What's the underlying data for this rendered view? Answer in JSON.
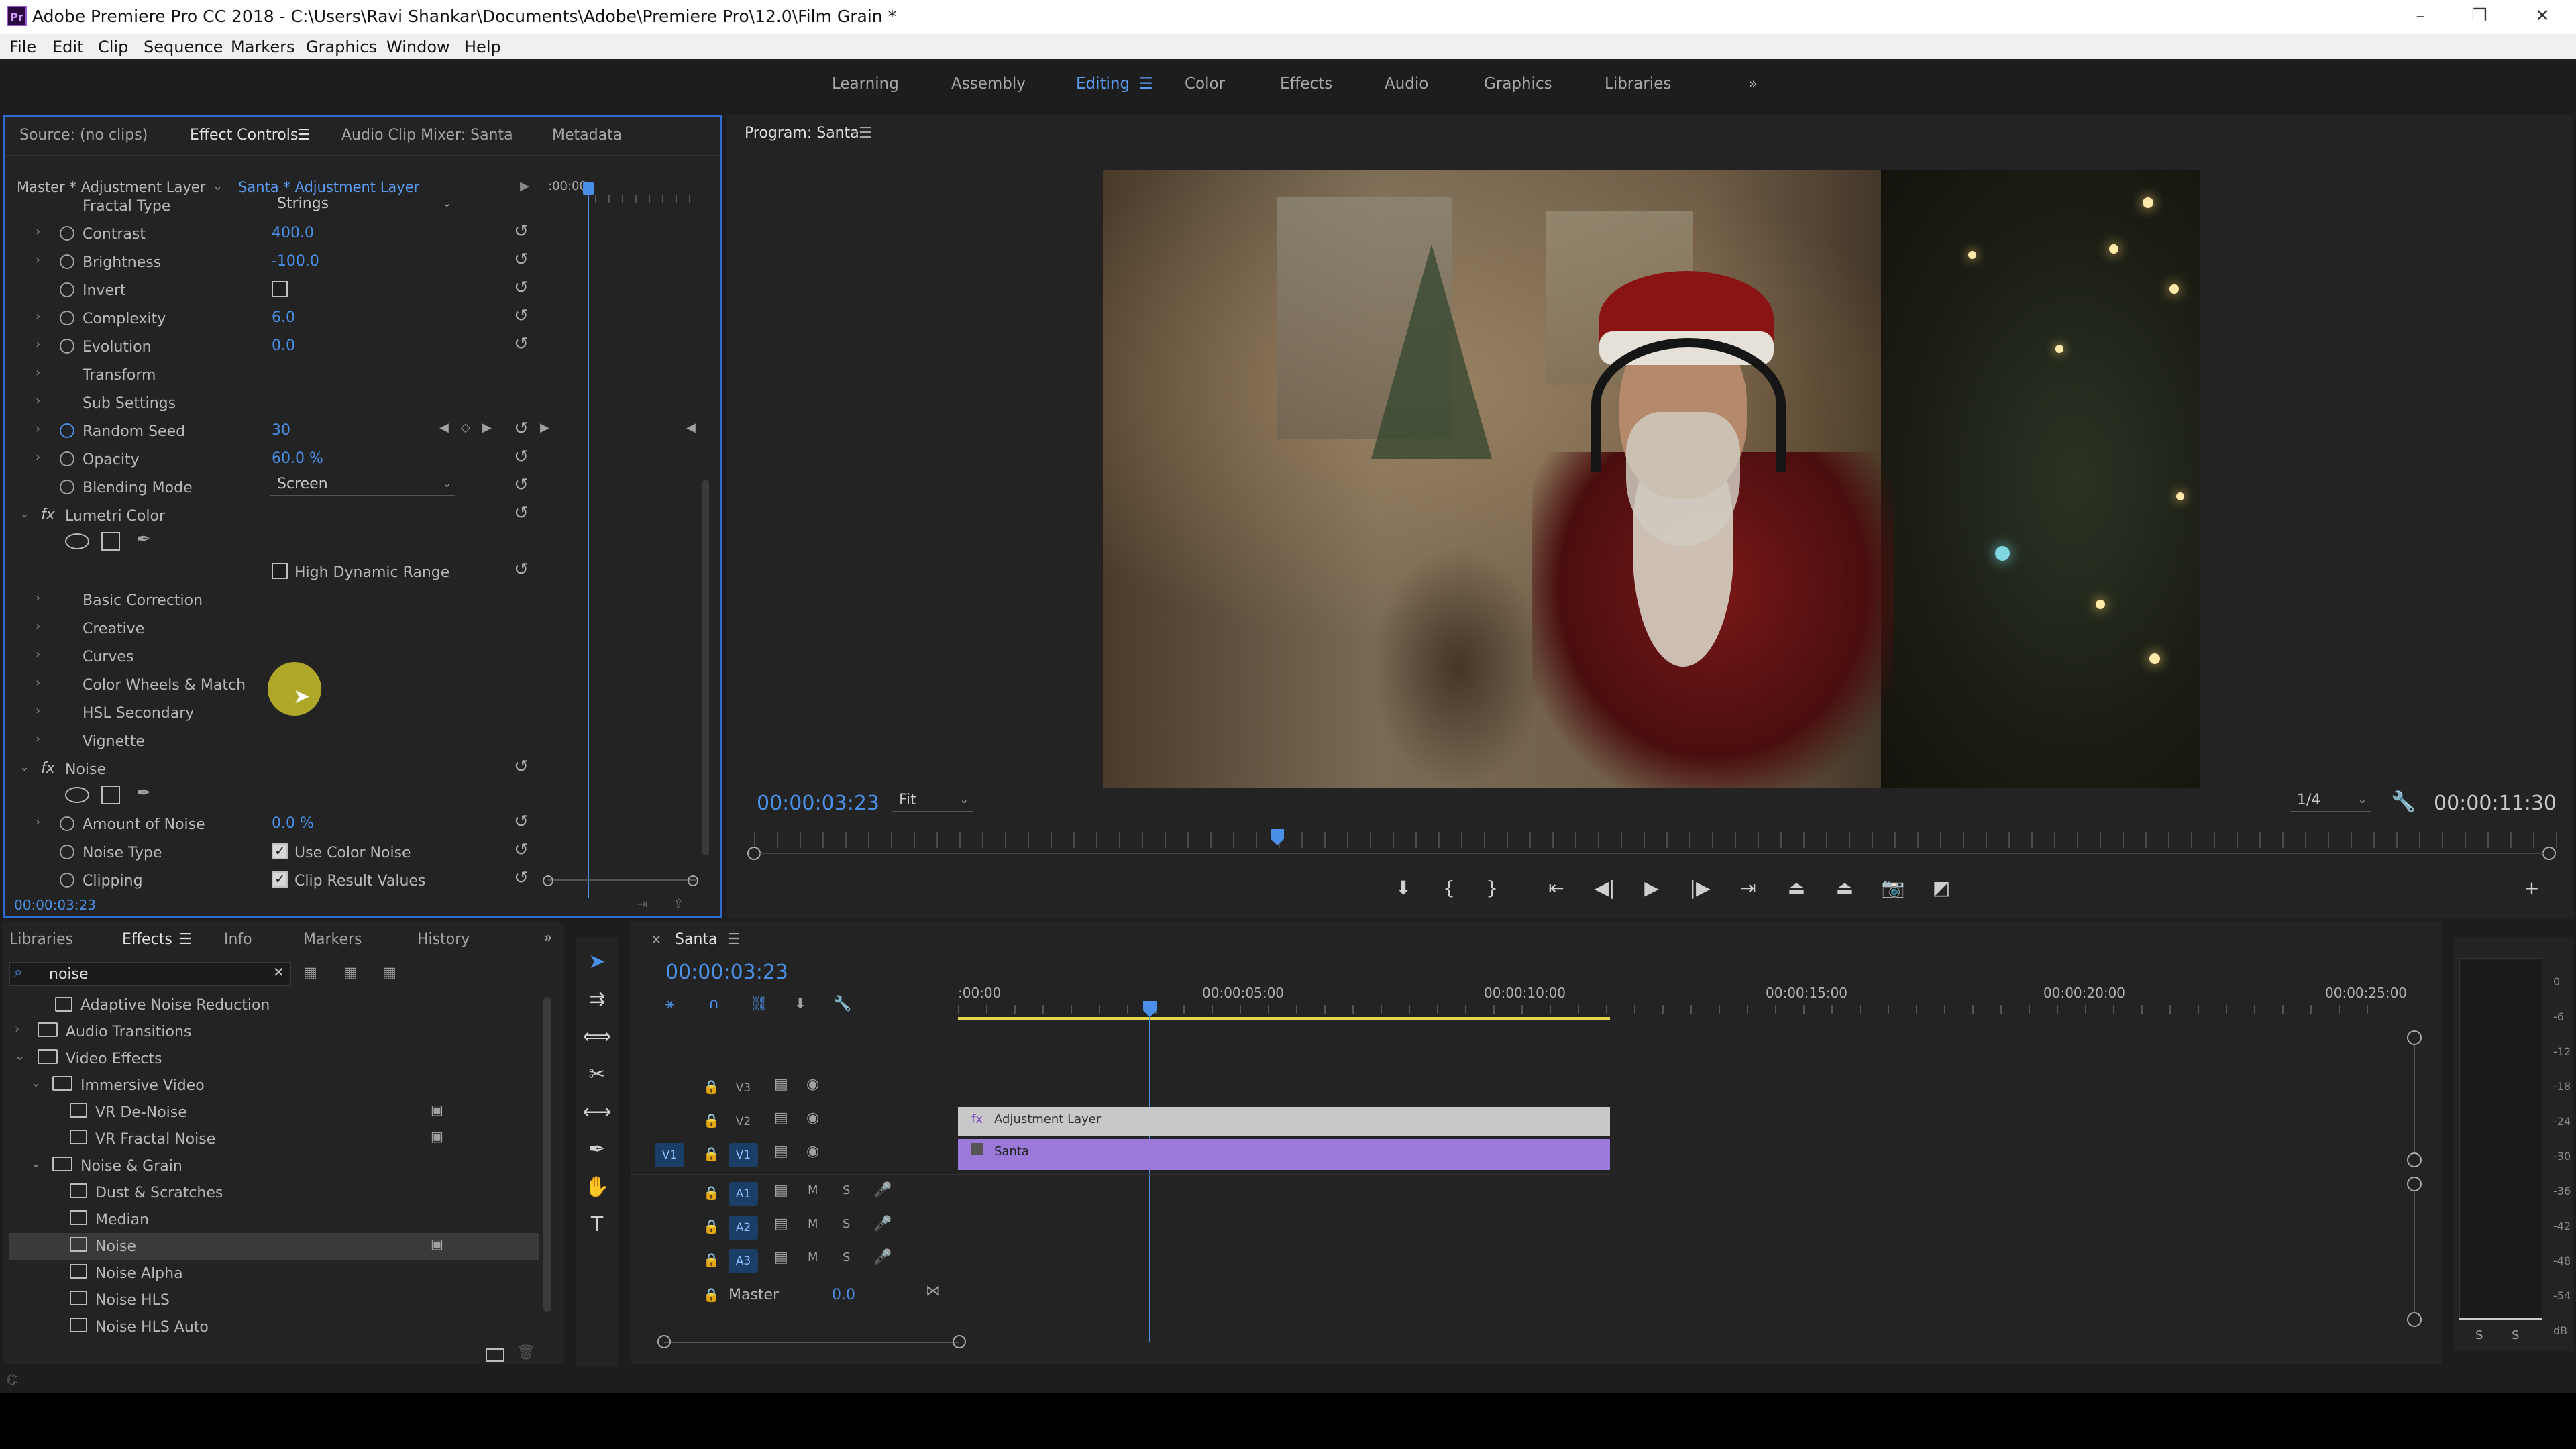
{
  "window": {
    "title": "Adobe Premiere Pro CC 2018 - C:\\Users\\Ravi Shankar\\Documents\\Adobe\\Premiere Pro\\12.0\\Film Grain *",
    "logo": "Pr"
  },
  "menu": [
    "File",
    "Edit",
    "Clip",
    "Sequence",
    "Markers",
    "Graphics",
    "Window",
    "Help"
  ],
  "workspaces": [
    "Learning",
    "Assembly",
    "Editing",
    "Color",
    "Effects",
    "Audio",
    "Graphics",
    "Libraries"
  ],
  "workspace_active": "Editing",
  "source_panel": {
    "tabs": [
      "Source: (no clips)",
      "Effect Controls",
      "Audio Clip Mixer: Santa",
      "Metadata"
    ],
    "master_label": "Master * Adjustment Layer",
    "clip_label": "Santa * Adjustment Layer",
    "mini_timecode": ":00:00",
    "rows": {
      "fractal_type": {
        "label": "Fractal Type",
        "value": "Strings"
      },
      "contrast": {
        "label": "Contrast",
        "value": "400.0"
      },
      "brightness": {
        "label": "Brightness",
        "value": "-100.0"
      },
      "invert": {
        "label": "Invert"
      },
      "complexity": {
        "label": "Complexity",
        "value": "6.0"
      },
      "evolution": {
        "label": "Evolution",
        "value": "0.0"
      },
      "transform": {
        "label": "Transform"
      },
      "sub_settings": {
        "label": "Sub Settings"
      },
      "random_seed": {
        "label": "Random Seed",
        "value": "30"
      },
      "opacity": {
        "label": "Opacity",
        "value": "60.0 %"
      },
      "blending_mode": {
        "label": "Blending Mode",
        "value": "Screen"
      },
      "lumetri": {
        "label": "Lumetri Color"
      },
      "hdr": {
        "label": "High Dynamic Range"
      },
      "basic_correction": {
        "label": "Basic Correction"
      },
      "creative": {
        "label": "Creative"
      },
      "curves": {
        "label": "Curves"
      },
      "color_wheels": {
        "label": "Color Wheels & Match"
      },
      "hsl_secondary": {
        "label": "HSL Secondary"
      },
      "vignette": {
        "label": "Vignette"
      },
      "noise": {
        "label": "Noise"
      },
      "amount_noise": {
        "label": "Amount of Noise",
        "value": "0.0 %"
      },
      "noise_type": {
        "label": "Noise Type",
        "value": "Use Color Noise"
      },
      "clipping": {
        "label": "Clipping",
        "value": "Clip Result Values"
      }
    },
    "fx_badge": "fx",
    "timecode": "00:00:03:23"
  },
  "program_panel": {
    "title": "Program: Santa",
    "timecode": "00:00:03:23",
    "fit": "Fit",
    "resolution": "1/4",
    "duration": "00:00:11:30",
    "playhead_fraction": 0.29
  },
  "effects_panel": {
    "tabs": [
      "Libraries",
      "Effects",
      "Info",
      "Markers",
      "History"
    ],
    "search_value": "noise",
    "items": [
      {
        "label": "Adaptive Noise Reduction",
        "level": 2,
        "kind": "effect"
      },
      {
        "label": "Audio Transitions",
        "level": 0,
        "kind": "folder"
      },
      {
        "label": "Video Effects",
        "level": 0,
        "kind": "folder"
      },
      {
        "label": "Immersive Video",
        "level": 1,
        "kind": "folder"
      },
      {
        "label": "VR De-Noise",
        "level": 2,
        "kind": "effect"
      },
      {
        "label": "VR Fractal Noise",
        "level": 2,
        "kind": "effect"
      },
      {
        "label": "Noise & Grain",
        "level": 1,
        "kind": "folder"
      },
      {
        "label": "Dust & Scratches",
        "level": 2,
        "kind": "effect"
      },
      {
        "label": "Median",
        "level": 2,
        "kind": "effect"
      },
      {
        "label": "Noise",
        "level": 2,
        "kind": "effect"
      },
      {
        "label": "Noise Alpha",
        "level": 2,
        "kind": "effect"
      },
      {
        "label": "Noise HLS",
        "level": 2,
        "kind": "effect"
      },
      {
        "label": "Noise HLS Auto",
        "level": 2,
        "kind": "effect"
      }
    ]
  },
  "timeline": {
    "sequence": "Santa",
    "timecode": "00:00:03:23",
    "ruler": [
      ":00:00",
      "00:00:05:00",
      "00:00:10:00",
      "00:00:15:00",
      "00:00:20:00",
      "00:00:25:00"
    ],
    "tracks_video": [
      "V3",
      "V2",
      "V1"
    ],
    "tracks_audio": [
      "A1",
      "A2",
      "A3"
    ],
    "source_patch": "V1",
    "m_label": "M",
    "s_label": "S",
    "master_label": "Master",
    "master_value": "0.0",
    "clip_adjustment": "Adjustment Layer",
    "clip_santa": "Santa"
  },
  "meter": {
    "labels": [
      "0",
      "-6",
      "-12",
      "-18",
      "-24",
      "-30",
      "-36",
      "-42",
      "-48",
      "-54",
      "dB"
    ],
    "solo": [
      "S",
      "S"
    ]
  },
  "colors": {
    "accent": "#4a90e8",
    "panel": "#232323",
    "adjustment_clip": "#c8c8c8",
    "santa_clip": "#9b79d9"
  }
}
